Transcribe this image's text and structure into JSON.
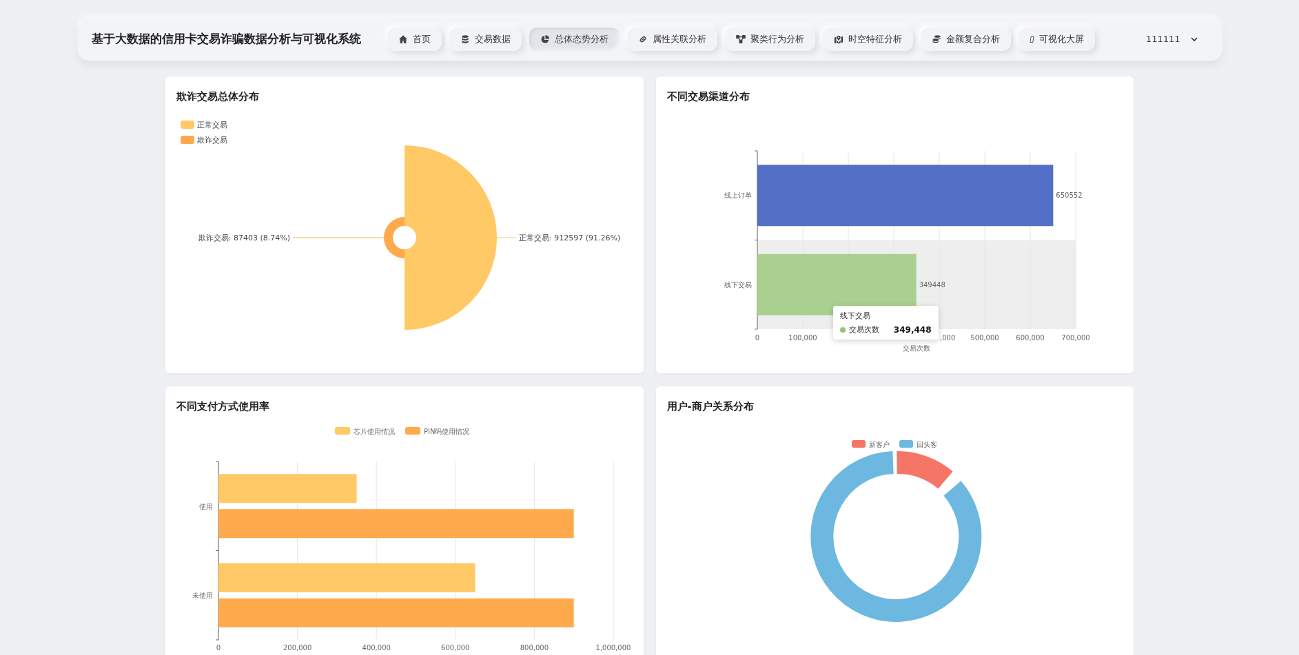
{
  "header": {
    "title": "基于大数据的信用卡交易诈骗数据分析与可视化系统",
    "nav": [
      {
        "label": "首页",
        "kind": "home",
        "selected": false
      },
      {
        "label": "交易数据",
        "kind": "database",
        "selected": false
      },
      {
        "label": "总体态势分析",
        "kind": "pie",
        "selected": true
      },
      {
        "label": "属性关联分析",
        "kind": "link",
        "selected": false
      },
      {
        "label": "聚类行为分析",
        "kind": "nodes",
        "selected": false
      },
      {
        "label": "时空特征分析",
        "kind": "map",
        "selected": false
      },
      {
        "label": "金额复合分析",
        "kind": "coins",
        "selected": false
      },
      {
        "label": "可视化大屏",
        "kind": "glyph",
        "selected": false
      }
    ],
    "user": "111111"
  },
  "fraud_distribution": {
    "title": "欺诈交易总体分布",
    "legend": [
      {
        "label": "正常交易",
        "color": "#ffc966"
      },
      {
        "label": "欺诈交易",
        "color": "#ffa94d"
      }
    ],
    "slice_labels": [
      "欺诈交易: 87403 (8.74%)",
      "正常交易: 912597 (91.26%)"
    ]
  },
  "channel_distribution": {
    "title": "不同交易渠道分布",
    "chart_data": {
      "bands": [
        {
          "axis": "y",
          "from": "线下交易",
          "to": "线下交易",
          "color": "#eeeeee"
        }
      ],
      "type": "bar",
      "orientation": "horizontal",
      "categories": [
        "线上订单",
        "线下交易"
      ],
      "series": [
        {
          "colors": [
            "#5470c6",
            "#a9d08e"
          ],
          "values": [
            650552,
            349448
          ]
        }
      ],
      "xlim": [
        0,
        700000
      ],
      "grid": true,
      "xticks": [
        0,
        {
          "value": 100000,
          "label": "100,000"
        },
        {
          "value": 500000,
          "label": "500,000"
        },
        {
          "value": 600000,
          "label": "600,000"
        },
        {
          "value": 700000,
          "label": "700,000"
        }
      ],
      "xlabel": "交易次数",
      "data_labels": true
    },
    "cut_tick_label": ",000",
    "tooltip": {
      "title": "线下交易",
      "series": "交易次数",
      "value": "349,448",
      "color": "#91c57a"
    }
  },
  "payment_usage": {
    "title": "不同支付方式使用率",
    "chart_data": {
      "type": "bar",
      "orientation": "horizontal",
      "legend": "top",
      "grid": true,
      "categories": [
        "使用",
        "未使用"
      ],
      "series": [
        {
          "name": "芯片使用情况",
          "color": "#ffc966",
          "values": [
            350000,
            650000
          ]
        },
        {
          "name": "PIN码使用情况",
          "color": "#ffaa4d",
          "values": [
            900000,
            900000
          ]
        }
      ],
      "xlim": [
        0,
        1000000
      ],
      "xticks": [
        0,
        {
          "value": 200000,
          "label": "200,000"
        },
        {
          "value": 400000,
          "label": "400,000"
        },
        {
          "value": 600000,
          "label": "600,000"
        },
        {
          "value": 800000,
          "label": "800,000"
        },
        {
          "value": 1000000,
          "label": "1,000,000"
        }
      ]
    }
  },
  "customer_relation": {
    "title": "用户-商户关系分布",
    "legend": [
      {
        "label": "新客户",
        "color": "#f57566"
      },
      {
        "label": "回头客",
        "color": "#6cb8e0"
      }
    ]
  }
}
